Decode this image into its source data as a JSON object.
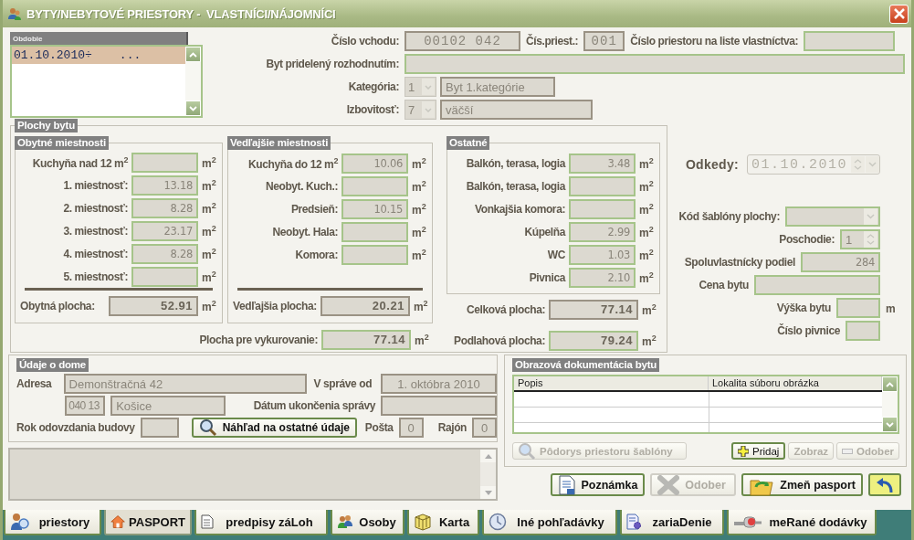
{
  "window": {
    "title": "BYTY/NEBYTOVÉ PRIESTORY -  VLASTNÍCI/NÁJOMNÍCI"
  },
  "periods": {
    "header": "Obdobie",
    "rows": [
      {
        "date": "01.10.2010÷",
        "more": "...",
        "selected": true
      }
    ]
  },
  "apartment": {
    "entrance": {
      "label": "Číslo vchodu:",
      "value": "00102 042",
      "editable": false
    },
    "space_number": {
      "label": "Čís.priest.:",
      "value": "001",
      "editable": false
    },
    "ownership_sheet_number": {
      "label": "Číslo priestoru na liste vlastníctva:",
      "editable": true
    },
    "allocated_by_decision": {
      "label": "Byt pridelený rozhodnutím:",
      "editable": true
    },
    "category": {
      "label": "Kategória:",
      "code": "1",
      "value": "Byt 1.kategórie"
    },
    "rooms": {
      "label": "Izbovitosť:",
      "code": "7",
      "value": "väčší"
    }
  },
  "areas": {
    "title": "Plochy bytu",
    "groups": [
      {
        "title": "Obytné miestnosti",
        "rows": [
          {
            "label": "Kuchyňa nad 12 m$^{2}$",
            "unit": "m$^{2}$",
            "editable": true
          },
          {
            "label": "1. miestnosť:",
            "value": "13.18",
            "unit": "m$^{2}$",
            "editable": true
          },
          {
            "label": "2. miestnosť:",
            "value": "8.28",
            "unit": "m$^{2}$",
            "editable": true
          },
          {
            "label": "3. miestnosť:",
            "value": "23.17",
            "unit": "m$^{2}$",
            "editable": true
          },
          {
            "label": "4. miestnosť:",
            "value": "8.28",
            "unit": "m$^{2}$",
            "editable": true
          },
          {
            "label": "5. miestnosť:",
            "unit": "m$^{2}$",
            "editable": true
          }
        ],
        "total": {
          "label": "Obytná plocha:",
          "value": "52.91",
          "unit": "m$^{2}$",
          "editable": false
        }
      },
      {
        "title": "Vedľajšie miestnosti",
        "rows": [
          {
            "label": "Kuchyňa do 12 m$^{2}$",
            "value": "10.06",
            "unit": "m$^{2}$",
            "editable": true
          },
          {
            "label": "Neobyt. Kuch.:",
            "unit": "m$^{2}$",
            "editable": true
          },
          {
            "label": "Predsieň:",
            "value": "10.15",
            "unit": "m$^{2}$",
            "editable": true
          },
          {
            "label": "Neobyt. Hala:",
            "unit": "m$^{2}$",
            "editable": true
          },
          {
            "label": "Komora:",
            "unit": "m$^{2}$",
            "editable": true
          }
        ],
        "total": {
          "label": "Vedľajšia plocha:",
          "value": "20.21",
          "unit": "m$^{2}$",
          "editable": false
        },
        "below": [
          {
            "label": "Plocha pre vykurovanie:",
            "value": "77.14",
            "unit": "m$^{2}$",
            "editable": true
          }
        ]
      },
      {
        "title": "Ostatné",
        "rows": [
          {
            "label": "Balkón, terasa, logia",
            "value": "3.48",
            "unit": "m$^{2}$",
            "editable": true
          },
          {
            "label": "Balkón, terasa, logia",
            "unit": "m$^{2}$",
            "editable": true
          },
          {
            "label": "Vonkajšia komora:",
            "unit": "m$^{2}$",
            "editable": true
          },
          {
            "label": "Kúpelňa",
            "value": "2.99",
            "unit": "m$^{2}$",
            "editable": true
          },
          {
            "label": "WC",
            "value": "1.03",
            "unit": "m$^{2}$",
            "editable": true
          },
          {
            "label": "Pivnica",
            "value": "2.10",
            "unit": "m$^{2}$",
            "editable": true
          }
        ],
        "below": [
          {
            "label": "Celková plocha:",
            "value": "77.14",
            "unit": "m$^{2}$",
            "editable": false
          },
          {
            "label": "Podlahová plocha:",
            "value": "79.24",
            "unit": "m$^{2}$",
            "editable": true
          }
        ]
      }
    ]
  },
  "details": [
    {
      "kind": "date",
      "label": "Odkedy:",
      "value": "01.10.2010",
      "disabled": true
    },
    {
      "kind": "combo",
      "label": "Kód šablóny plochy:"
    },
    {
      "kind": "spinner",
      "label": "Poschodie:",
      "value": "1"
    },
    {
      "kind": "text",
      "label": "Spoluvlastnícky podiel",
      "value": "284"
    },
    {
      "kind": "text",
      "label": "Cena bytu"
    },
    {
      "kind": "text",
      "label": "Výška bytu",
      "unit": "m"
    },
    {
      "kind": "text",
      "label": "Číslo pivnice"
    }
  ],
  "house": {
    "title": "Údaje o dome",
    "address": {
      "label": "Adresa",
      "value": "Demonštračná 42"
    },
    "managed_since": {
      "label": "V správe od",
      "value": "1. októbra 2010"
    },
    "zip": {
      "value": "040 13"
    },
    "city": {
      "value": "Košice"
    },
    "management_end": {
      "label": "Dátum ukončenia správy"
    },
    "handover_year": {
      "label": "Rok odovzdania budovy"
    },
    "preview_button": {
      "label": "Náhľad na ostatné údaje"
    },
    "post": {
      "label": "Pošta",
      "value": "0"
    },
    "district": {
      "label": "Rajón",
      "value": "0"
    }
  },
  "photos": {
    "title": "Obrazová dokumentácia bytu",
    "columns": [
      "Popis",
      "Lokalita súboru obrázka"
    ],
    "buttons": [
      {
        "kind": "floorplan",
        "label": "Pôdorys priestoru šablóny",
        "disabled": true
      },
      {
        "kind": "add",
        "label": "Pridaj",
        "disabled": false
      },
      {
        "kind": "view",
        "label": "Zobraz",
        "disabled": true
      },
      {
        "kind": "remove",
        "label": "Odober",
        "disabled": true
      }
    ]
  },
  "actions": [
    {
      "kind": "note",
      "label": "Poznámka",
      "disabled": false
    },
    {
      "kind": "delete",
      "label": "Odober",
      "disabled": true
    },
    {
      "kind": "change",
      "label": "Zmeň pasport",
      "disabled": false
    },
    {
      "kind": "undo",
      "disabled": false
    }
  ],
  "tabs": [
    {
      "kind": "person-search",
      "label": "priestory",
      "selected": false
    },
    {
      "kind": "house",
      "label": "PASPORT",
      "selected": true
    },
    {
      "kind": "document",
      "label": "predpisy záLoh",
      "selected": false
    },
    {
      "kind": "people",
      "label": "Osoby",
      "selected": false
    },
    {
      "kind": "box",
      "label": "Karta",
      "selected": false
    },
    {
      "kind": "clock",
      "label": "Iné pohľadávky",
      "selected": false
    },
    {
      "kind": "gear-doc",
      "label": "zariaDenie",
      "selected": false
    },
    {
      "kind": "meter",
      "label": "meRané dodávky",
      "selected": false
    }
  ]
}
